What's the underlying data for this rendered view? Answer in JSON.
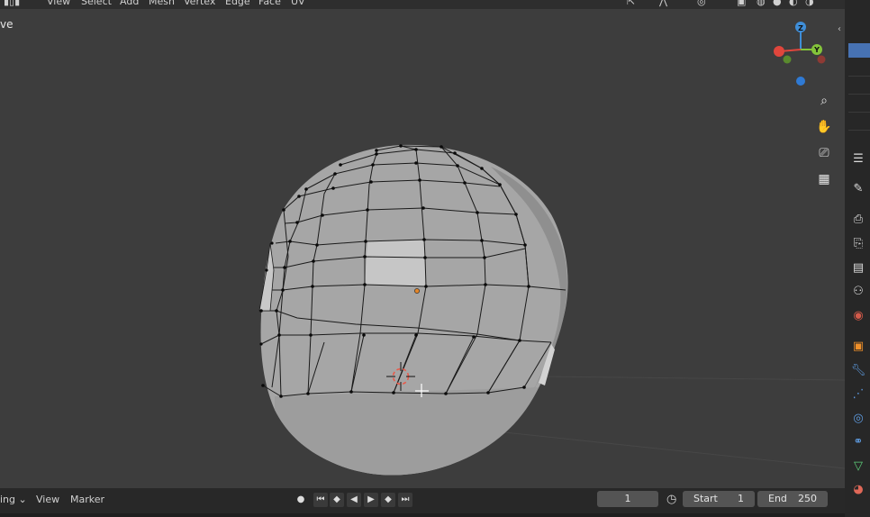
{
  "header": {
    "menus": [
      "View",
      "Select",
      "Add",
      "Mesh",
      "Vertex",
      "Edge",
      "Face",
      "UV"
    ]
  },
  "viewport": {
    "mode_label": "ve"
  },
  "gizmo": {
    "z_label": "Z",
    "y_label": "Y"
  },
  "timeline": {
    "playback_label": "ing",
    "view_label": "View",
    "marker_label": "Marker",
    "current_frame": "1",
    "start_label": "Start",
    "start_value": "1",
    "end_label": "End",
    "end_value": "250"
  },
  "colors": {
    "background": "#3d3d3d",
    "header": "#2e2e2e",
    "mesh": "#a7a7a7",
    "vertex": "#0a0a0a",
    "axis_x": "#e0463c",
    "axis_y": "#84c43a",
    "axis_z": "#3f8ed8",
    "selection": "#4772b3"
  }
}
